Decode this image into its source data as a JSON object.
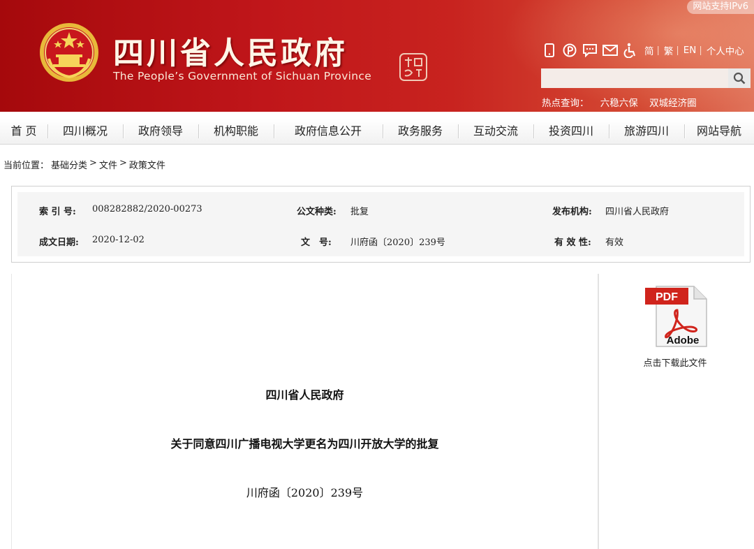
{
  "header": {
    "title_cn": "四川省人民政府",
    "title_en": "The People’s Government of Sichuan Province",
    "ipv6": "网站支持IPv6",
    "tools": {
      "icons": [
        "mobile-icon",
        "weibo-icon",
        "chat-icon",
        "mail-icon",
        "accessibility-icon"
      ],
      "lang_simplified": "简",
      "lang_traditional": "繁",
      "lang_english": "EN",
      "personal_center": "个人中心",
      "separator": "|"
    },
    "search": {
      "placeholder": "",
      "value": ""
    },
    "hot": {
      "label": "热点查询：",
      "items": [
        "六稳六保",
        "双城经济圈"
      ]
    }
  },
  "nav": {
    "items": [
      "首 页",
      "四川概况",
      "政府领导",
      "机构职能",
      "政府信息公开",
      "政务服务",
      "互动交流",
      "投资四川",
      "旅游四川",
      "网站导航"
    ]
  },
  "breadcrumb": {
    "label": "当前位置：",
    "items": [
      "基础分类",
      "文件",
      "政策文件"
    ],
    "separator": ">"
  },
  "meta": {
    "index_label": "索 引 号:",
    "index_value": "008282882/2020-00273",
    "type_label": "公文种类:",
    "type_value": "批复",
    "publisher_label": "发布机构:",
    "publisher_value": "四川省人民政府",
    "date_label": "成文日期:",
    "date_value": "2020-12-02",
    "docno_label": "文　号:",
    "docno_value": "川府函〔2020〕239号",
    "validity_label": "有 效 性:",
    "validity_value": "有效"
  },
  "document": {
    "issuer": "四川省人民政府",
    "title": "关于同意四川广播电视大学更名为四川开放大学的批复",
    "number": "川府函〔2020〕239号"
  },
  "download": {
    "pdf_badge": "PDF",
    "brand": "Adobe",
    "label": "点击下载此文件"
  },
  "colors": {
    "header_red": "#c0161a",
    "pdf_red": "#d0241c"
  }
}
